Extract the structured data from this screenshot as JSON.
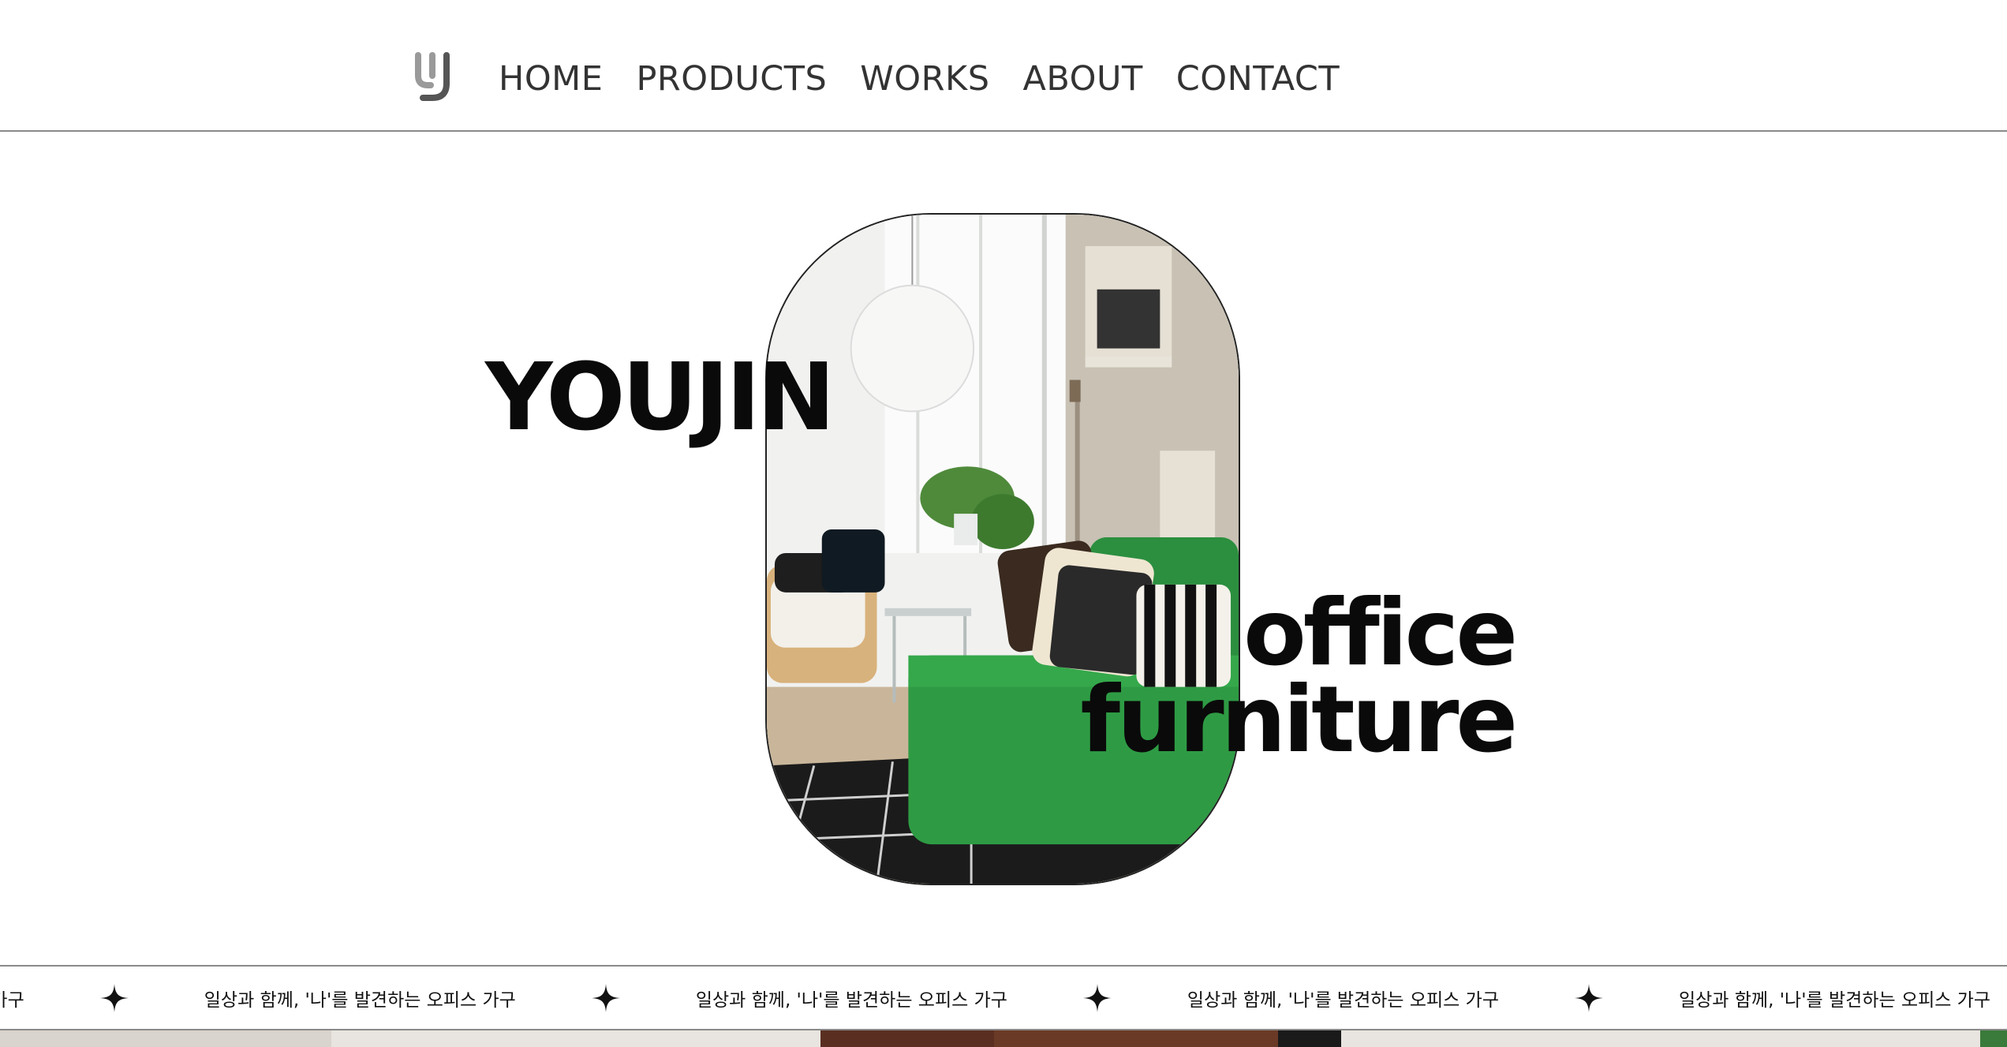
{
  "brand": {
    "logo_icon": "yj-monogram-icon"
  },
  "nav": {
    "items": [
      {
        "label": "HOME"
      },
      {
        "label": "PRODUCTS"
      },
      {
        "label": "WORKS"
      },
      {
        "label": "ABOUT"
      },
      {
        "label": "CONTACT"
      }
    ]
  },
  "hero": {
    "title_left": "YOUJIN",
    "title_right_line1": "office",
    "title_right_line2": "furniture",
    "image_icon": "living-room-photo"
  },
  "band": {
    "text": "일상과 함께, '나'를 발견하는 오피스 가구",
    "leading_fragment": "하는 오피스 가구",
    "separator_icon": "four-point-star-icon"
  },
  "colors": {
    "text": "#0a0a0a",
    "nav_text": "#333333",
    "divider": "#8a8a8a",
    "sofa_green": "#2e9b44"
  }
}
